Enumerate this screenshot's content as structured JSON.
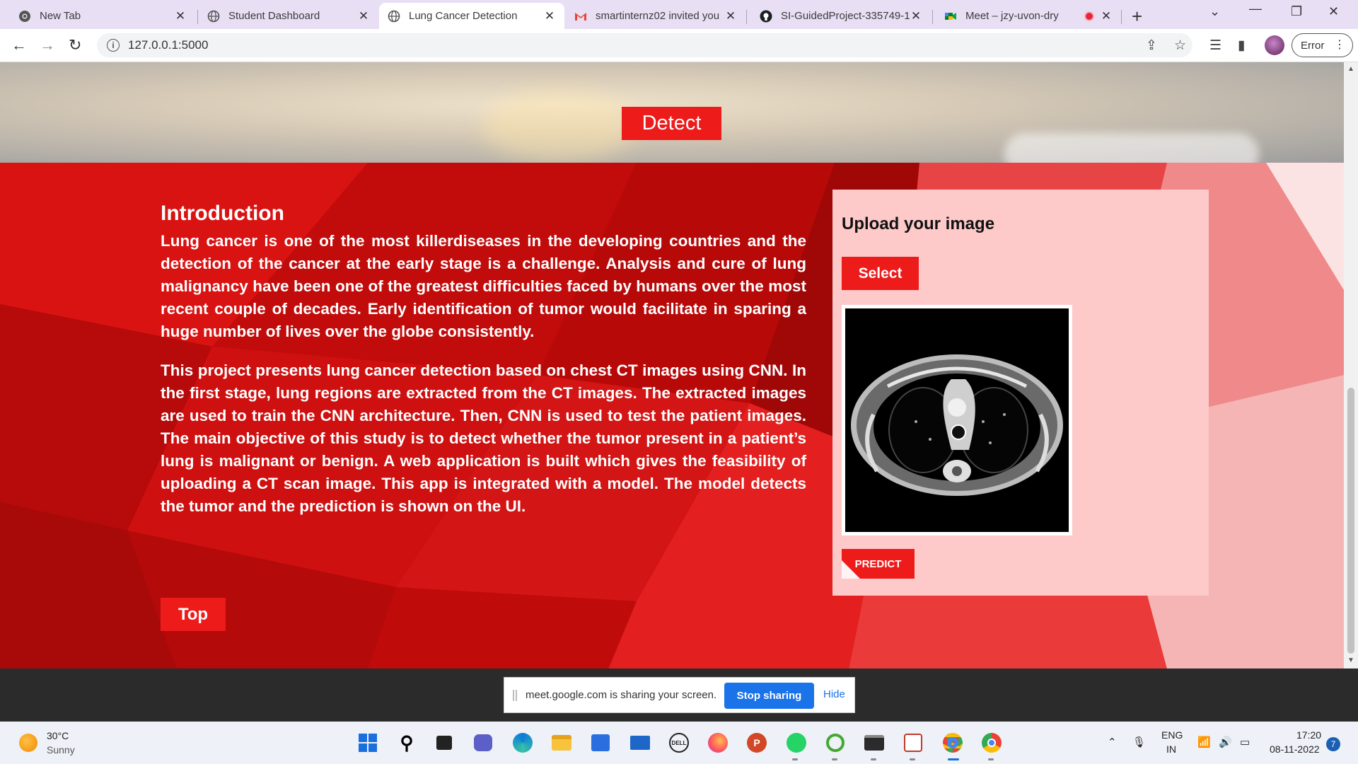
{
  "browser": {
    "tabs": [
      {
        "title": "New Tab",
        "icon": "chrome-icon"
      },
      {
        "title": "Student Dashboard",
        "icon": "globe-icon"
      },
      {
        "title": "Lung Cancer Detection",
        "icon": "globe-icon"
      },
      {
        "title": "smartinternz02 invited you",
        "icon": "gmail-icon"
      },
      {
        "title": "SI-GuidedProject-335749-1",
        "icon": "github-icon"
      },
      {
        "title": "Meet – jzy-uvon-dry",
        "icon": "meet-icon"
      }
    ],
    "url": "127.0.0.1:5000",
    "error_label": "Error"
  },
  "page": {
    "detect_label": "Detect",
    "intro_title": "Introduction",
    "para1": "Lung cancer is one of the most killerdiseases in the developing countries and the detection of the cancer at the early stage is a challenge. Analysis and cure of lung malignancy have been one of the greatest difficulties faced by humans over the most recent couple of decades. Early identification of tumor would facilitate in sparing a huge number of lives over the globe consistently.",
    "para2": "This project presents lung cancer detection based on chest CT images using CNN. In the first stage, lung regions are extracted from the CT images. The extracted images are used to train the CNN architecture. Then, CNN is used to test the patient images. The main objective of this study is to detect whether the tumor present in a patient’s lung is malignant or benign. A web application is built which gives the feasibility of uploading a CT scan image. This app is integrated with a model. The model detects the tumor and the prediction is shown on the UI.",
    "top_label": "Top",
    "upload_title": "Upload your image",
    "select_label": "Select",
    "predict_label": "PREDICT"
  },
  "sharing": {
    "message": "meet.google.com is sharing your screen.",
    "stop_label": "Stop sharing",
    "hide_label": "Hide"
  },
  "taskbar": {
    "temperature": "30°C",
    "weather": "Sunny",
    "lang": "ENG",
    "region": "IN",
    "time": "17:20",
    "date": "08-11-2022",
    "notifications": "7"
  },
  "colors": {
    "accent_red": "#ee1b1b",
    "section_red": "#c90c0c",
    "card_pink": "#fdc9c9",
    "share_blue": "#1a73e8"
  }
}
